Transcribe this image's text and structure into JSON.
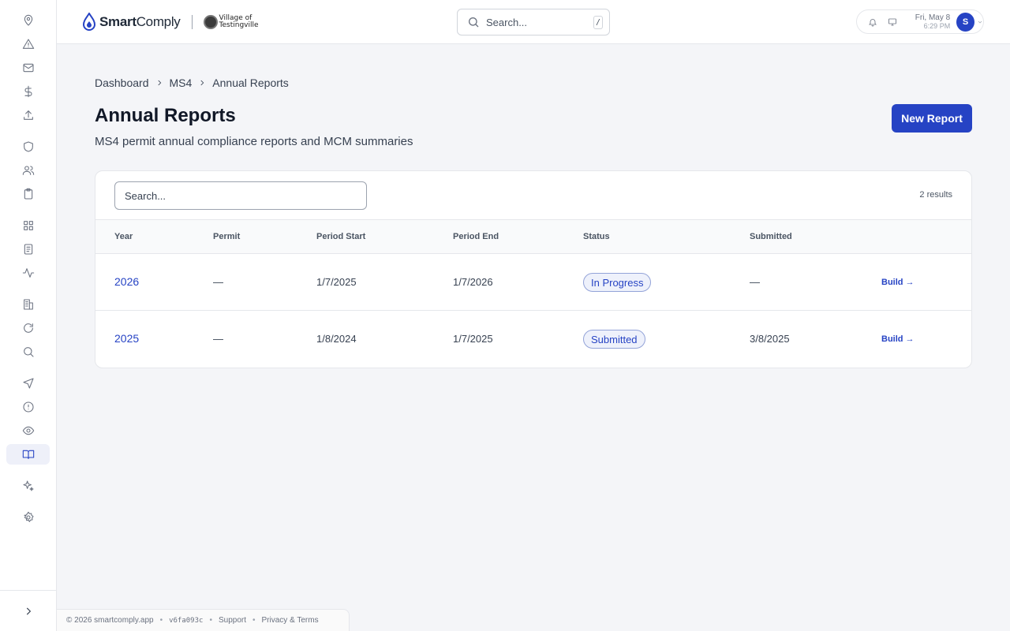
{
  "brand": {
    "name_bold": "Smart",
    "name_light": "Comply",
    "village_line1": "Village of",
    "village_line2": "Testingville"
  },
  "topbar": {
    "search_placeholder": "Search...",
    "search_shortcut": "/",
    "date": "Fri, May 8",
    "time": "6:29 PM",
    "avatar_initial": "S"
  },
  "sidebar": {
    "icons": [
      "map-pin-icon",
      "warning-icon",
      "mail-icon",
      "dollar-icon",
      "upload-icon",
      "shield-icon",
      "users-icon",
      "clipboard-icon",
      "grid-icon",
      "document-icon",
      "activity-icon",
      "building-icon",
      "refresh-icon",
      "search-icon",
      "send-icon",
      "alert-circle-icon",
      "eye-icon",
      "book-open-icon",
      "sparkles-icon",
      "settings-icon"
    ],
    "active": "book-open-icon"
  },
  "breadcrumb": [
    "Dashboard",
    "MS4",
    "Annual Reports"
  ],
  "page": {
    "title": "Annual Reports",
    "subtitle": "MS4 permit annual compliance reports and MCM summaries",
    "new_button": "New Report"
  },
  "table": {
    "search_placeholder": "Search...",
    "results": "2 results",
    "headers": [
      "Year",
      "Permit",
      "Period Start",
      "Period End",
      "Status",
      "Submitted"
    ],
    "rows": [
      {
        "year": "2026",
        "permit": "—",
        "period_start": "1/7/2025",
        "period_end": "1/7/2026",
        "status": "In Progress",
        "submitted": "—",
        "action": "Build →"
      },
      {
        "year": "2025",
        "permit": "—",
        "period_start": "1/8/2024",
        "period_end": "1/7/2025",
        "status": "Submitted",
        "submitted": "3/8/2025",
        "action": "Build →"
      }
    ]
  },
  "footer": {
    "copyright": "© 2026 smartcomply.app",
    "version": "v6fa093c",
    "support": "Support",
    "privacy": "Privacy & Terms"
  },
  "colors": {
    "accent": "#2643c4",
    "background": "#f4f5f8"
  }
}
